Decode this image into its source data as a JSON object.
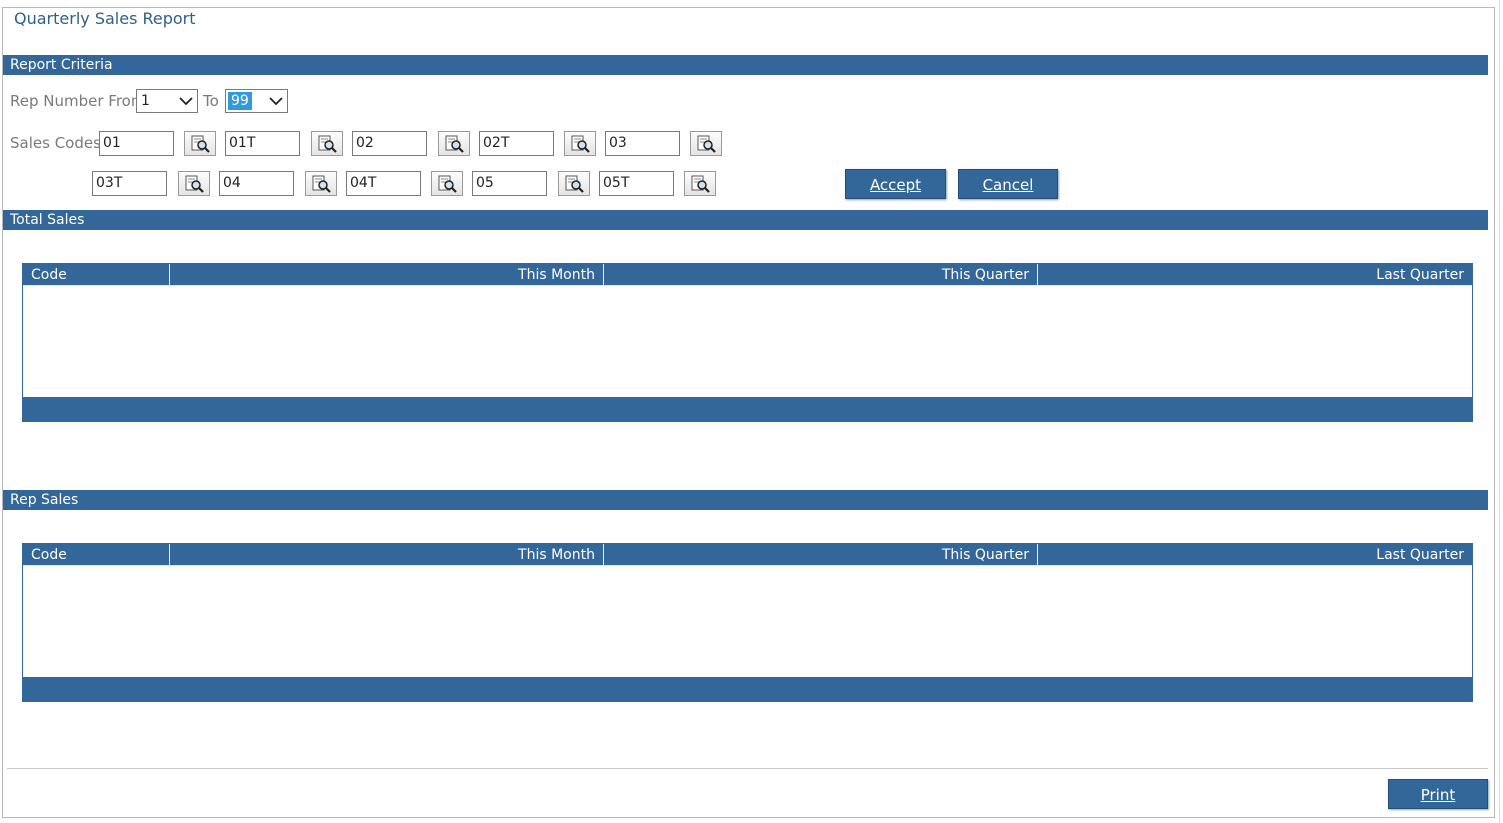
{
  "page": {
    "title": "Quarterly Sales Report"
  },
  "criteria": {
    "section_label": "Report Criteria",
    "rep_from_label": "Rep Number From",
    "rep_from_value": "1",
    "rep_to_label": "To",
    "rep_to_value": "99",
    "sales_codes_label": "Sales Codes",
    "codes_row1": [
      "01",
      "01T",
      "02",
      "02T",
      "03"
    ],
    "codes_row2": [
      "03T",
      "04",
      "04T",
      "05",
      "05T"
    ],
    "accept_label": "Accept",
    "cancel_label": "Cancel"
  },
  "total_sales": {
    "section_label": "Total Sales",
    "columns": [
      "Code",
      "This Month",
      "This Quarter",
      "Last Quarter"
    ],
    "rows": []
  },
  "rep_sales": {
    "section_label": "Rep Sales",
    "columns": [
      "Code",
      "This Month",
      "This Quarter",
      "Last Quarter"
    ],
    "rows": []
  },
  "footer": {
    "print_label": "Print"
  },
  "colors": {
    "accent": "#336699",
    "title": "#2f5f8a",
    "selection": "#3399dd"
  },
  "icons": {
    "lookup": "magnifier-document-icon",
    "dropdown": "chevron-down-icon"
  }
}
